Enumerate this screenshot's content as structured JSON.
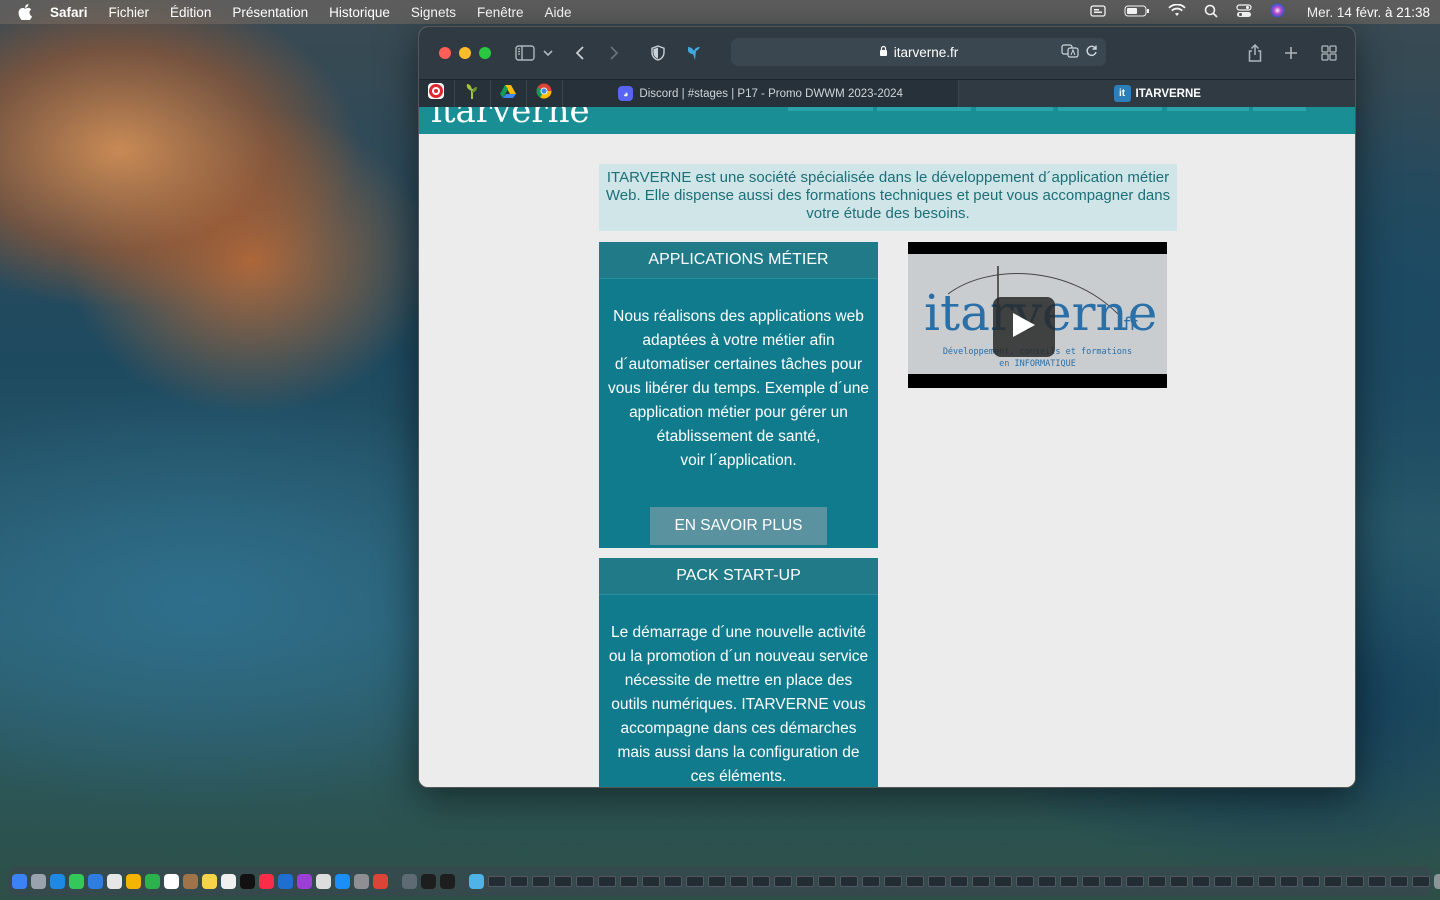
{
  "menubar": {
    "app": "Safari",
    "items": [
      "Fichier",
      "Édition",
      "Présentation",
      "Historique",
      "Signets",
      "Fenêtre",
      "Aide"
    ],
    "clock": "Mer. 14 févr. à  21:38"
  },
  "browser": {
    "url": "itarverne.fr",
    "tabs": [
      {
        "title": "Discord | #stages | P17 - Promo DWWM 2023-2024",
        "icon": "discord-icon"
      },
      {
        "title": "ITARVERNE",
        "icon": "itarverne-icon",
        "active": true
      }
    ],
    "pinned": [
      "pinned-tab-red-icon",
      "pinned-tab-plant-icon",
      "pinned-tab-drive-icon",
      "pinned-tab-chrome-icon"
    ]
  },
  "site": {
    "intro": "ITARVERNE est une société spécialisée dans le développement d´application métier Web. Elle dispense aussi des formations techniques et peut vous accompagner dans votre étude des besoins.",
    "cards": [
      {
        "title": "APPLICATIONS MÉTIER",
        "lines": [
          "Nous réalisons des applications web",
          "adaptées à votre métier afin",
          "d´automatiser certaines tâches pour",
          "vous libérer du temps. Exemple d´une",
          "application métier pour gérer un",
          "établissement de santé,",
          "voir l´application."
        ],
        "button": "EN SAVOIR PLUS"
      },
      {
        "title": "PACK START-UP",
        "lines": [
          "Le démarrage d´une nouvelle activité",
          "ou la promotion d´un nouveau service",
          "nécessite de mettre en place des",
          "outils numériques. ITARVERNE vous",
          "accompagne dans ces démarches",
          "mais aussi dans la configuration de",
          "ces éléments."
        ]
      }
    ],
    "video": {
      "logo": "itarverne",
      "logo_suffix": ".fr",
      "caption1": "Développement, conseils et formations",
      "caption2": "en INFORMATIQUE"
    }
  },
  "colors": {
    "accent": "#1a8e95",
    "card": "#0f7b8d",
    "intro_bg": "#cfe5e7"
  }
}
